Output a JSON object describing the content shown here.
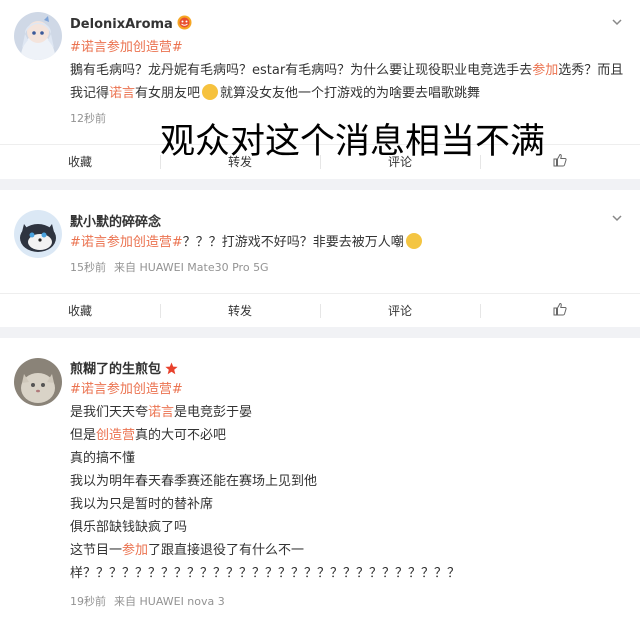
{
  "posts": [
    {
      "username": "DelonixAroma",
      "topic": "#诺言参加创造营#",
      "body": [
        [
          "鵝有毛病吗？龙丹妮有毛病吗？estar有毛病吗？为什么要让现役职业电竞选手去",
          "参加",
          "选秀？而且"
        ],
        [
          "我记得",
          "诺言",
          "有女朋友吧",
          "就算没女友他一个打游戏的为啥要去唱歌跳舞"
        ]
      ],
      "time": "12秒前",
      "device": ""
    },
    {
      "username": "默小默的碎碎念",
      "topic": "#诺言参加创造营#",
      "body_rest": "？？？打游戏不好吗？非要去被万人嘲",
      "time": "15秒前",
      "device": "来自 HUAWEI Mate30 Pro 5G"
    },
    {
      "username": "煎糊了的生煎包",
      "topic": "#诺言参加创造营#",
      "lines": [
        [
          "是我们天天夸",
          "诺言",
          "是电竞彭于晏"
        ],
        [
          "但是",
          "创造营",
          "真的大可不必吧"
        ],
        [
          "真的搞不懂"
        ],
        [
          "我以为明年春天春季赛还能在赛场上见到他"
        ],
        [
          "我以为只是暂时的替补席"
        ],
        [
          "俱乐部缺钱缺疯了吗"
        ],
        [
          "这节目一",
          "参加",
          "了跟直接退役了有什么不一"
        ],
        [
          "样？？？？？？？？？？？？？？？？？？？？？？？？？？？？？"
        ]
      ],
      "time": "19秒前",
      "device": "来自 HUAWEI nova 3"
    }
  ],
  "actions": {
    "favorite": "收藏",
    "repost": "转发",
    "comment": "评论"
  },
  "overlay_caption": "观众对这个消息相当不满",
  "colors": {
    "topic": "#eb7350",
    "meta": "#939393",
    "text": "#333333",
    "background": "#f1f2f5"
  },
  "icons": [
    "verified-badge-icon",
    "chevron-down-icon",
    "thumbs-up-icon",
    "hot-badge-icon",
    "star-badge-icon"
  ]
}
